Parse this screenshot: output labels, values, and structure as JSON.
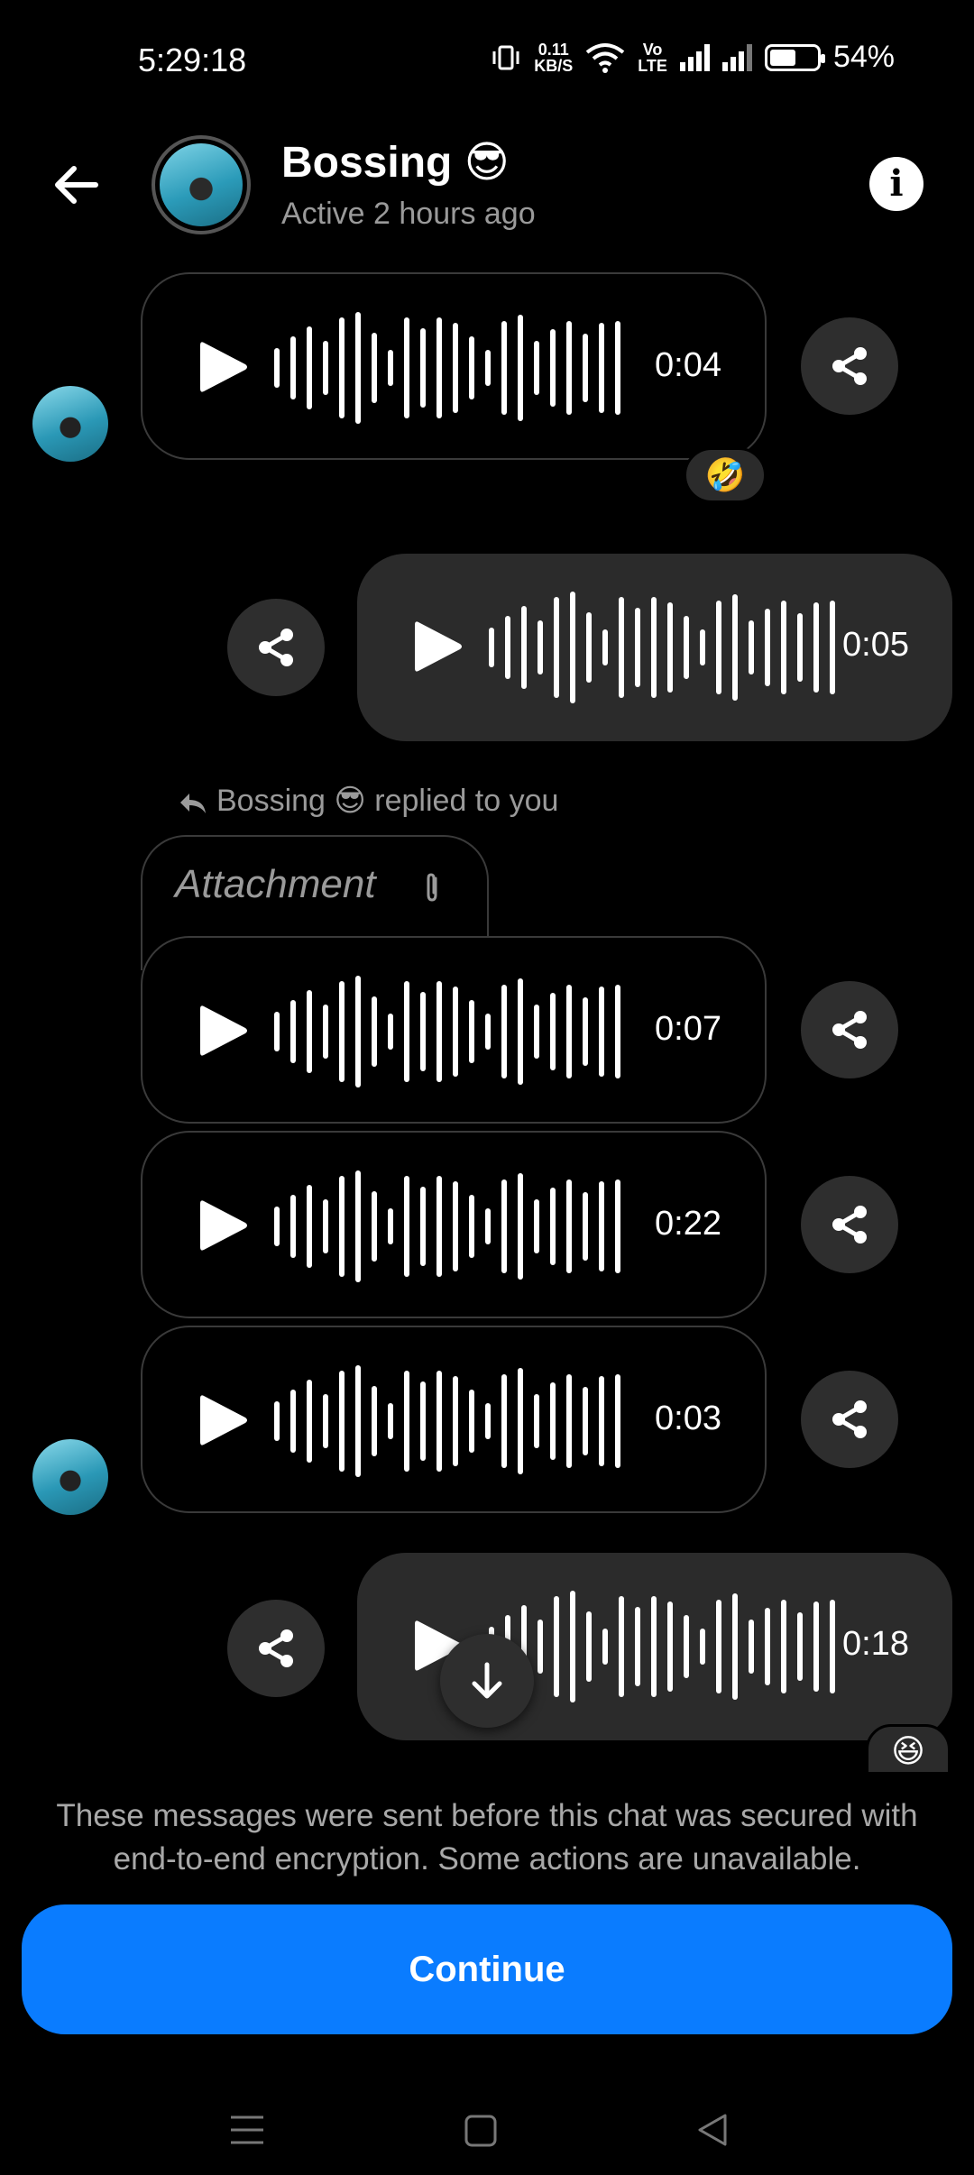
{
  "status_bar": {
    "time": "5:29:18",
    "net_speed_value": "0.11",
    "net_speed_unit": "KB/S",
    "volte_top": "Vo",
    "volte_bottom": "LTE",
    "battery_percent": "54%",
    "icons": [
      "vibrate-icon",
      "wifi-icon",
      "volte-icon",
      "signal-icon",
      "signal-icon",
      "battery-icon"
    ]
  },
  "header": {
    "name": "Bossing 😎",
    "status": "Active 2 hours ago",
    "back_icon": "arrow-left-icon",
    "info_icon": "info-icon",
    "info_glyph": "i"
  },
  "messages": [
    {
      "direction": "in",
      "duration": "0:04",
      "reaction": "🤣"
    },
    {
      "direction": "out",
      "duration": "0:05"
    },
    {
      "direction": "in",
      "duration": "0:07"
    },
    {
      "direction": "in",
      "duration": "0:22"
    },
    {
      "direction": "in",
      "duration": "0:03"
    },
    {
      "direction": "out",
      "duration": "0:18",
      "reaction": "😆"
    }
  ],
  "reply": {
    "label": "Bossing 😎 replied to you",
    "attachment_text": "Attachment"
  },
  "footer": {
    "notice": "These messages were sent before this chat was secured with end-to-end encryption. Some actions are unavailable.",
    "continue_label": "Continue"
  },
  "colors": {
    "accent": "#0a7cff",
    "bubble_out": "#2b2b2b",
    "muted_text": "#9a9a9a"
  }
}
